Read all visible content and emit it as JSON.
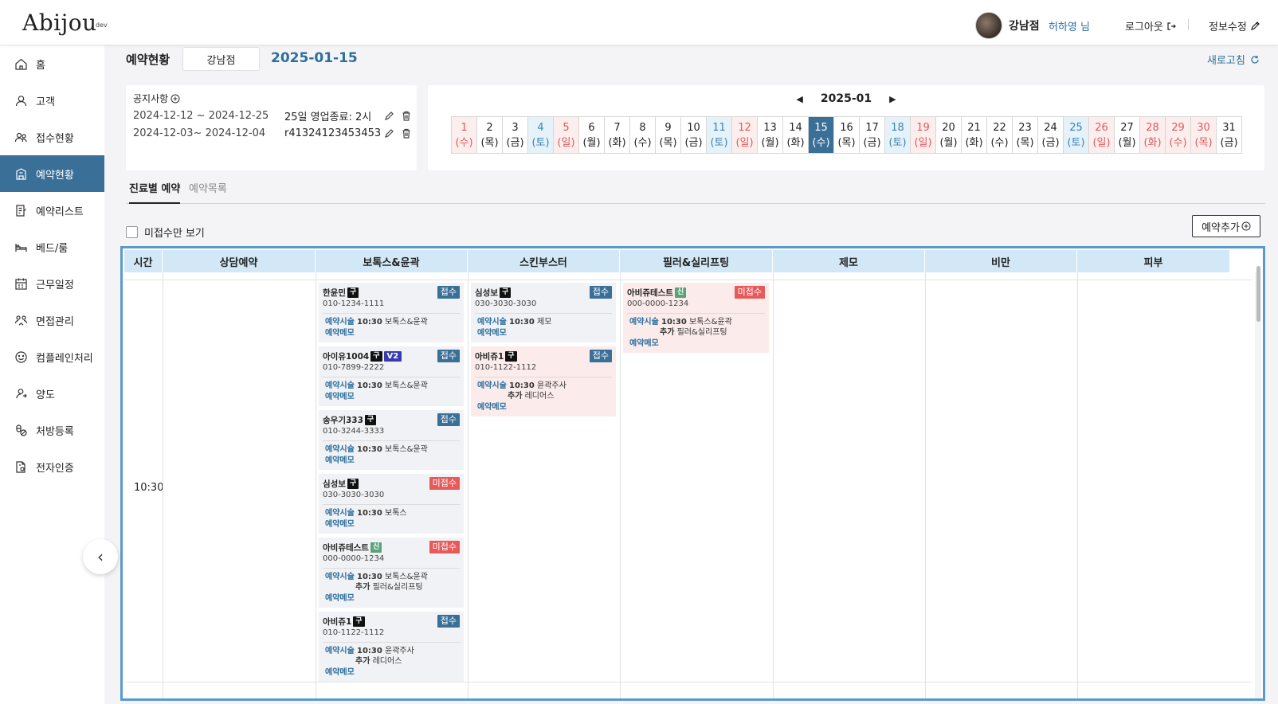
{
  "header": {
    "logo": "Abijou",
    "logo_sup": "dev",
    "branch": "강남점",
    "user": "허하영 님",
    "logout": "로그아웃",
    "edit_info": "정보수정"
  },
  "sidebar": {
    "items": [
      {
        "label": "홈",
        "icon": "home-icon"
      },
      {
        "label": "고객",
        "icon": "user-icon"
      },
      {
        "label": "접수현황",
        "icon": "users-icon"
      },
      {
        "label": "예약현황",
        "icon": "building-icon"
      },
      {
        "label": "예약리스트",
        "icon": "list-icon"
      },
      {
        "label": "베드/룸",
        "icon": "bed-icon"
      },
      {
        "label": "근무일정",
        "icon": "calendar-icon"
      },
      {
        "label": "면접관리",
        "icon": "interview-icon"
      },
      {
        "label": "컴플레인처리",
        "icon": "smile-icon"
      },
      {
        "label": "양도",
        "icon": "transfer-icon"
      },
      {
        "label": "처방등록",
        "icon": "prescription-icon"
      },
      {
        "label": "전자인증",
        "icon": "certificate-icon"
      }
    ],
    "collapse": "‹"
  },
  "main": {
    "title": "예약현황",
    "branch_select": "강남점",
    "date": "2025-01-15",
    "refresh": "새로고침"
  },
  "notice": {
    "title": "공지사항",
    "rows": [
      {
        "range": "2024-12-12 ~ 2024-12-25",
        "text": "25일 영업종료: 2시"
      },
      {
        "range": "2024-12-03~ 2024-12-04",
        "text": "r41324123453453..."
      }
    ]
  },
  "calendar": {
    "month": "2025-01",
    "days": [
      {
        "d": "1",
        "w": "(수)",
        "t": "holiday"
      },
      {
        "d": "2",
        "w": "(목)",
        "t": ""
      },
      {
        "d": "3",
        "w": "(금)",
        "t": ""
      },
      {
        "d": "4",
        "w": "(토)",
        "t": "sat"
      },
      {
        "d": "5",
        "w": "(일)",
        "t": "sun"
      },
      {
        "d": "6",
        "w": "(월)",
        "t": ""
      },
      {
        "d": "7",
        "w": "(화)",
        "t": ""
      },
      {
        "d": "8",
        "w": "(수)",
        "t": ""
      },
      {
        "d": "9",
        "w": "(목)",
        "t": ""
      },
      {
        "d": "10",
        "w": "(금)",
        "t": ""
      },
      {
        "d": "11",
        "w": "(토)",
        "t": "sat"
      },
      {
        "d": "12",
        "w": "(일)",
        "t": "sun"
      },
      {
        "d": "13",
        "w": "(월)",
        "t": ""
      },
      {
        "d": "14",
        "w": "(화)",
        "t": ""
      },
      {
        "d": "15",
        "w": "(수)",
        "t": "sel"
      },
      {
        "d": "16",
        "w": "(목)",
        "t": ""
      },
      {
        "d": "17",
        "w": "(금)",
        "t": ""
      },
      {
        "d": "18",
        "w": "(토)",
        "t": "sat"
      },
      {
        "d": "19",
        "w": "(일)",
        "t": "sun"
      },
      {
        "d": "20",
        "w": "(월)",
        "t": ""
      },
      {
        "d": "21",
        "w": "(화)",
        "t": ""
      },
      {
        "d": "22",
        "w": "(수)",
        "t": ""
      },
      {
        "d": "23",
        "w": "(목)",
        "t": ""
      },
      {
        "d": "24",
        "w": "(금)",
        "t": ""
      },
      {
        "d": "25",
        "w": "(토)",
        "t": "sat"
      },
      {
        "d": "26",
        "w": "(일)",
        "t": "sun"
      },
      {
        "d": "27",
        "w": "(월)",
        "t": ""
      },
      {
        "d": "28",
        "w": "(화)",
        "t": "holiday"
      },
      {
        "d": "29",
        "w": "(수)",
        "t": "holiday"
      },
      {
        "d": "30",
        "w": "(목)",
        "t": "holiday"
      },
      {
        "d": "31",
        "w": "(금)",
        "t": ""
      }
    ]
  },
  "tabs": {
    "active": "진료별 예약",
    "inactive": "예약목록"
  },
  "filter": {
    "label": "미접수만 보기"
  },
  "add_button": "예약추가",
  "grid": {
    "columns": [
      "시간",
      "상담예약",
      "보톡스&윤곽",
      "스킨부스터",
      "필러&실리프팅",
      "제모",
      "비만",
      "피부"
    ],
    "time": "10:30",
    "labels": {
      "treatment": "예약시술",
      "extra": "추가",
      "memo": "예약메모"
    },
    "cards": [
      {
        "col": 2,
        "name": "한윤민",
        "badge": "구",
        "badge2": "",
        "phone": "010-1234-1111",
        "status": "접수",
        "time": "10:30",
        "treat": "보톡스&윤곽",
        "extra": "",
        "pink": false
      },
      {
        "col": 2,
        "name": "아이유1004",
        "badge": "구",
        "badge2": "V2",
        "phone": "010-7899-2222",
        "status": "접수",
        "time": "10:30",
        "treat": "보톡스&윤곽",
        "extra": "",
        "pink": false
      },
      {
        "col": 2,
        "name": "송우기333",
        "badge": "구",
        "badge2": "",
        "phone": "010-3244-3333",
        "status": "접수",
        "time": "10:30",
        "treat": "보톡스&윤곽",
        "extra": "",
        "pink": false
      },
      {
        "col": 2,
        "name": "심성보",
        "badge": "구",
        "badge2": "",
        "phone": "030-3030-3030",
        "status": "미접수",
        "time": "10:30",
        "treat": "보톡스",
        "extra": "",
        "pink": false
      },
      {
        "col": 2,
        "name": "아비쥬테스트",
        "badge": "신",
        "badge2": "",
        "phone": "000-0000-1234",
        "status": "미접수",
        "time": "10:30",
        "treat": "보톡스&윤곽",
        "extra": "필러&실리프팅",
        "pink": false
      },
      {
        "col": 2,
        "name": "아비쥬1",
        "badge": "구",
        "badge2": "",
        "phone": "010-1122-1112",
        "status": "접수",
        "time": "10:30",
        "treat": "윤곽주사",
        "extra": "레디어스",
        "pink": false
      },
      {
        "col": 3,
        "name": "심성보",
        "badge": "구",
        "badge2": "",
        "phone": "030-3030-3030",
        "status": "접수",
        "time": "10:30",
        "treat": "제모",
        "extra": "",
        "pink": false
      },
      {
        "col": 3,
        "name": "아비쥬1",
        "badge": "구",
        "badge2": "",
        "phone": "010-1122-1112",
        "status": "접수",
        "time": "10:30",
        "treat": "윤곽주사",
        "extra": "레디어스",
        "pink": true
      },
      {
        "col": 4,
        "name": "아비쥬테스트",
        "badge": "신",
        "badge2": "",
        "phone": "000-0000-1234",
        "status": "미접수",
        "time": "10:30",
        "treat": "보톡스&윤곽",
        "extra": "필러&실리프팅",
        "pink": true
      }
    ]
  },
  "colors": {
    "primary": "#3a6f98",
    "accent_text": "#2c6e9e",
    "danger": "#e85a5a",
    "header_bg": "#d3e8f6"
  }
}
